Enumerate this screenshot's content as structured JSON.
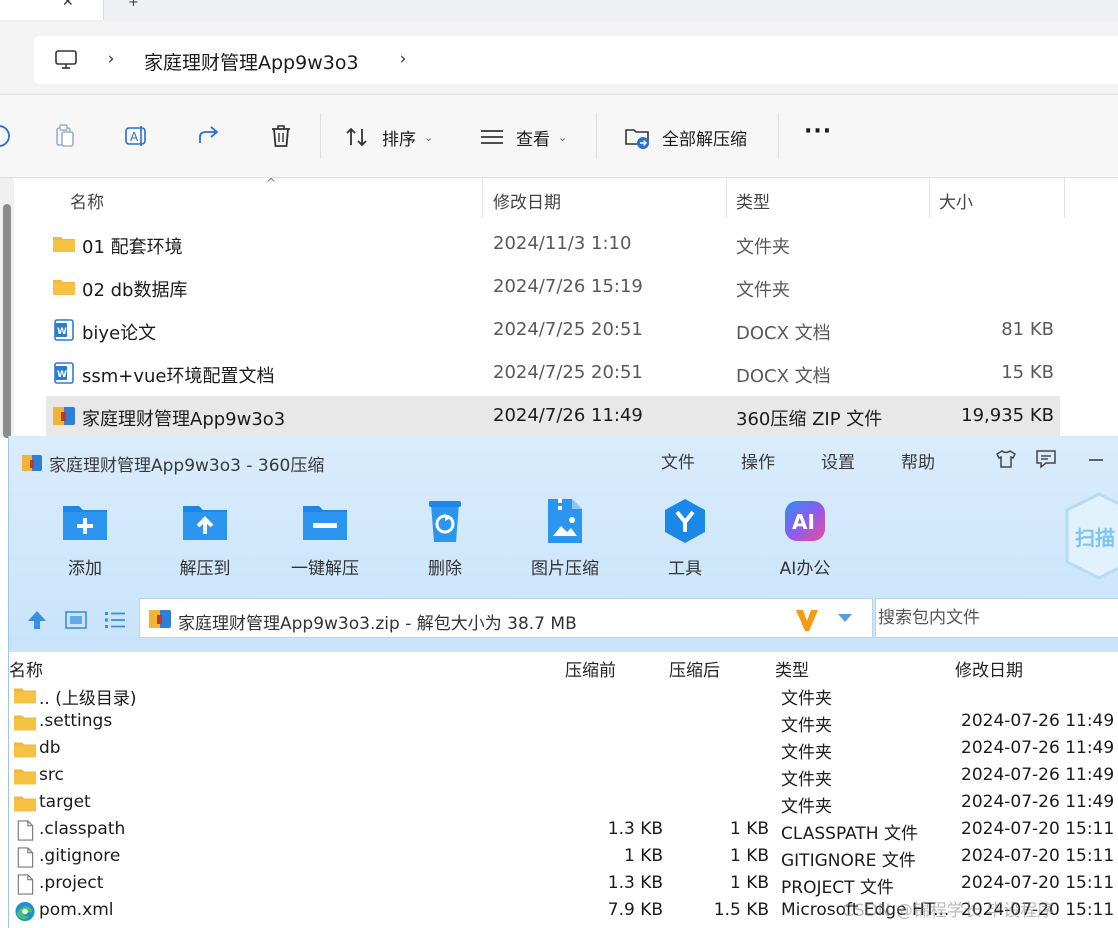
{
  "explorer": {
    "breadcrumb": {
      "current": "家庭理财管理App9w3o3"
    },
    "toolbar": {
      "sort_label": "排序",
      "view_label": "查看",
      "extract_all_label": "全部解压缩",
      "more_label": "···"
    },
    "columns": {
      "name": "名称",
      "modified": "修改日期",
      "type": "类型",
      "size": "大小"
    },
    "rows": [
      {
        "name": "01 配套环境",
        "modified": "2024/11/3 1:10",
        "type": "文件夹",
        "size": "",
        "icon": "folder-icon"
      },
      {
        "name": "02 db数据库",
        "modified": "2024/7/26 15:19",
        "type": "文件夹",
        "size": "",
        "icon": "folder-icon"
      },
      {
        "name": "biye论文",
        "modified": "2024/7/25 20:51",
        "type": "DOCX 文档",
        "size": "81 KB",
        "icon": "word-doc-icon"
      },
      {
        "name": "ssm+vue环境配置文档",
        "modified": "2024/7/25 20:51",
        "type": "DOCX 文档",
        "size": "15 KB",
        "icon": "word-doc-icon"
      },
      {
        "name": "家庭理财管理App9w3o3",
        "modified": "2024/7/26 11:49",
        "type": "360压缩 ZIP 文件",
        "size": "19,935 KB",
        "icon": "zip-archive-icon"
      }
    ]
  },
  "zip": {
    "title": "家庭理财管理App9w3o3 - 360压缩",
    "menu": [
      "文件",
      "操作",
      "设置",
      "帮助"
    ],
    "tools": [
      "添加",
      "解压到",
      "一键解压",
      "删除",
      "图片压缩",
      "工具",
      "AI办公"
    ],
    "scan_label": "扫描",
    "ai_badge": "AI",
    "path": "家庭理财管理App9w3o3.zip - 解包大小为 38.7 MB",
    "search_placeholder": "搜索包内文件",
    "columns": {
      "name": "名称",
      "before": "压缩前",
      "after": "压缩后",
      "type": "类型",
      "modified": "修改日期"
    },
    "rows": [
      {
        "name": ".. (上级目录)",
        "before": "",
        "after": "",
        "type": "文件夹",
        "modified": "",
        "icon": "folder-icon"
      },
      {
        "name": ".settings",
        "before": "",
        "after": "",
        "type": "文件夹",
        "modified": "2024-07-26 11:49",
        "icon": "folder-icon"
      },
      {
        "name": "db",
        "before": "",
        "after": "",
        "type": "文件夹",
        "modified": "2024-07-26 11:49",
        "icon": "folder-icon"
      },
      {
        "name": "src",
        "before": "",
        "after": "",
        "type": "文件夹",
        "modified": "2024-07-26 11:49",
        "icon": "folder-icon"
      },
      {
        "name": "target",
        "before": "",
        "after": "",
        "type": "文件夹",
        "modified": "2024-07-26 11:49",
        "icon": "folder-icon"
      },
      {
        "name": ".classpath",
        "before": "1.3 KB",
        "after": "1 KB",
        "type": "CLASSPATH 文件",
        "modified": "2024-07-20 15:11",
        "icon": "file-icon"
      },
      {
        "name": ".gitignore",
        "before": "1 KB",
        "after": "1 KB",
        "type": "GITIGNORE 文件",
        "modified": "2024-07-20 15:11",
        "icon": "file-icon"
      },
      {
        "name": ".project",
        "before": "1.3 KB",
        "after": "1 KB",
        "type": "PROJECT 文件",
        "modified": "2024-07-20 15:11",
        "icon": "file-icon"
      },
      {
        "name": "pom.xml",
        "before": "7.9 KB",
        "after": "1.5 KB",
        "type": "Microsoft Edge HT...",
        "modified": "2024-07-20 15:11",
        "icon": "edge-icon"
      }
    ]
  },
  "watermark": "CSDN @锦程学长 毕设程序",
  "colors": {
    "folder": "#f6c244",
    "zip_blue": "#1b88e8",
    "selection": "#e8e8e8",
    "zip_header_bg": "#d3e9fc"
  }
}
